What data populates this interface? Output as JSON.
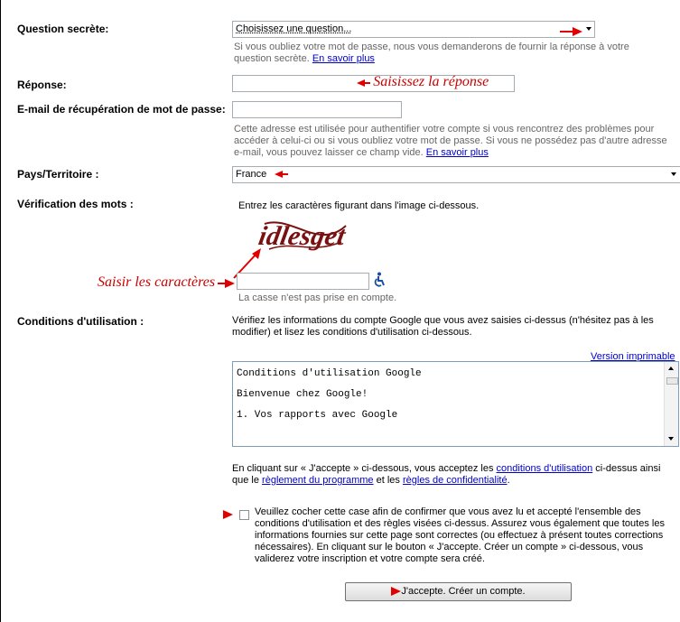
{
  "security_question": {
    "label": "Question secrète:",
    "selected": "Choisissez une question...",
    "help": "Si vous oubliez votre mot de passe, nous vous demanderons de fournir la réponse à votre question secrète.",
    "learn_more": "En savoir plus"
  },
  "answer": {
    "label": "Réponse:",
    "value": "",
    "annotation": "Saisissez la réponse"
  },
  "recovery_email": {
    "label": "E-mail de récupération de mot de passe:",
    "value": "",
    "help": "Cette adresse est utilisée pour authentifier votre compte si vous rencontrez des problèmes pour accéder à celui-ci ou si vous oubliez votre mot de passe. Si vous ne possédez pas d'autre adresse e-mail, vous pouvez laisser ce champ vide.",
    "learn_more": "En savoir plus"
  },
  "country": {
    "label": "Pays/Territoire :",
    "selected": "France"
  },
  "word_verification": {
    "label": "Vérification des mots :",
    "instruction": "Entrez les caractères figurant dans l'image ci-dessous.",
    "captcha_text": "idlesget",
    "annotation": "Saisir les caractères",
    "value": "",
    "case_note": "La casse n'est pas prise en compte."
  },
  "terms": {
    "label": "Conditions d'utilisation :",
    "intro": "Vérifiez les informations du compte Google que vous avez saisies ci-dessus (n'hésitez pas à les modifier) et lisez les conditions d'utilisation ci-dessous.",
    "printable_link": "Version imprimable",
    "tos_lines": [
      "Conditions d'utilisation Google",
      "Bienvenue chez Google!",
      "1. Vos rapports avec Google"
    ],
    "accept_text_1": "En cliquant sur « J'accepte » ci-dessous, vous acceptez les",
    "accept_link_1": "conditions d'utilisation",
    "accept_text_2": "ci-dessus ainsi que le",
    "accept_link_2": "règlement du programme",
    "accept_text_3": "et les",
    "accept_link_3": "règles de confidentialité",
    "accept_text_4": ".",
    "checkbox_text": "Veuillez cocher cette case afin de confirmer que vous avez lu et accepté l'ensemble des conditions d'utilisation et des règles visées ci-dessus. Assurez vous également que toutes les informations fournies sur cette page sont correctes (ou effectuez à présent toutes corrections nécessaires). En cliquant sur le bouton « J'accepte. Créer un compte » ci-dessous, vous validerez votre inscription et votre compte sera créé.",
    "checkbox_checked": false,
    "submit_label": "J'accepte. Créer un compte."
  },
  "colors": {
    "annotation_red": "#cc0000",
    "link_blue": "#0000cc",
    "help_gray": "#666666"
  }
}
